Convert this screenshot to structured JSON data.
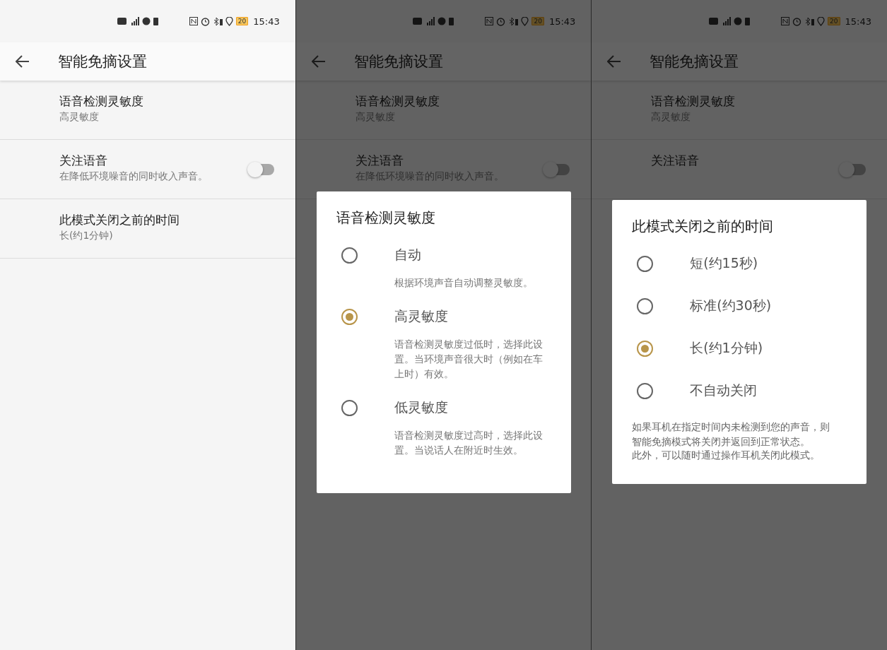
{
  "screens": [
    {
      "status_bar": {
        "battery": "20",
        "time": "15:43"
      },
      "app_bar": {
        "title": "智能免摘设置"
      },
      "settings": [
        {
          "kind": "value",
          "title": "语音检测灵敏度",
          "subtitle": "高灵敏度"
        },
        {
          "kind": "toggle",
          "title": "关注语音",
          "subtitle": "在降低环境噪音的同时收入声音。",
          "on": false
        },
        {
          "kind": "value",
          "title": "此模式关闭之前的时间",
          "subtitle": "长(约1分钟)"
        }
      ]
    },
    {
      "status_bar": {
        "battery": "20",
        "time": "15:43"
      },
      "app_bar": {
        "title": "智能免摘设置"
      },
      "settings": [
        {
          "kind": "value",
          "title": "语音检测灵敏度",
          "subtitle": "高灵敏度"
        },
        {
          "kind": "toggle",
          "title": "关注语音",
          "subtitle": "在降低环境噪音的同时收入声音。",
          "on": false
        }
      ],
      "dialog": {
        "title": "语音检测灵敏度",
        "options": [
          {
            "label": "自动",
            "description": "根据环境声音自动调整灵敏度。",
            "selected": false
          },
          {
            "label": "高灵敏度",
            "description": "语音检测灵敏度过低时，选择此设置。当环境声音很大时（例如在车上时）有效。",
            "selected": true
          },
          {
            "label": "低灵敏度",
            "description": "语音检测灵敏度过高时，选择此设置。当说话人在附近时生效。",
            "selected": false
          }
        ]
      }
    },
    {
      "status_bar": {
        "battery": "20",
        "time": "15:43"
      },
      "app_bar": {
        "title": "智能免摘设置"
      },
      "settings": [
        {
          "kind": "value",
          "title": "语音检测灵敏度",
          "subtitle": "高灵敏度"
        },
        {
          "kind": "toggle",
          "title": "关注语音",
          "on": false
        }
      ],
      "dialog": {
        "title": "此模式关闭之前的时间",
        "options": [
          {
            "label": "短(约15秒)",
            "selected": false
          },
          {
            "label": "标准(约30秒)",
            "selected": false
          },
          {
            "label": "长(约1分钟)",
            "selected": true
          },
          {
            "label": "不自动关闭",
            "selected": false
          }
        ],
        "notes": [
          "如果耳机在指定时间内未检测到您的声音，则智能免摘模式将关闭并返回到正常状态。",
          "此外，可以随时通过操作耳机关闭此模式。"
        ]
      }
    }
  ]
}
